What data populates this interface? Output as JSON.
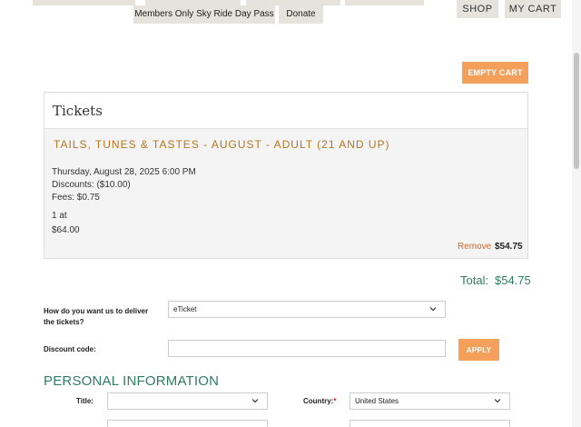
{
  "nav": {
    "members_only_label": "Members Only Sky Ride Day Pass",
    "donate_label": "Donate",
    "shop_label": "SHOP",
    "cart_label": "MY CART"
  },
  "cart": {
    "empty_cart_label": "EMPTY CART",
    "tickets_heading": "Tickets",
    "item": {
      "title": "TAILS, TUNES & TASTES - AUGUST - ADULT (21 AND UP)",
      "date": "Thursday, August 28, 2025 6:00 PM",
      "discounts": "Discounts: ($10.00)",
      "fees": "Fees: $0.75",
      "quantity": "1 at",
      "unit_price": "$64.00",
      "remove_label": "Remove",
      "line_total": "$54.75"
    },
    "total_label": "Total:",
    "total_value": "$54.75"
  },
  "form": {
    "delivery_label_1": "How do you want us to deliver",
    "delivery_label_2": "the tickets?",
    "delivery_value": "eTicket",
    "discount_label": "Discount code:",
    "discount_value": "",
    "apply_label": "APPLY",
    "personal_heading": "PERSONAL INFORMATION",
    "title_label": "Title:",
    "title_value": "",
    "country_label": "Country:",
    "country_required": "*",
    "country_value": "United States"
  },
  "icons": {
    "chevron": "chevron-down-icon"
  },
  "colors": {
    "accent_orange": "#f5a05a",
    "event_title": "#b8761f",
    "heading_green": "#2e7d62",
    "nav_bg": "#e6e2dc"
  }
}
